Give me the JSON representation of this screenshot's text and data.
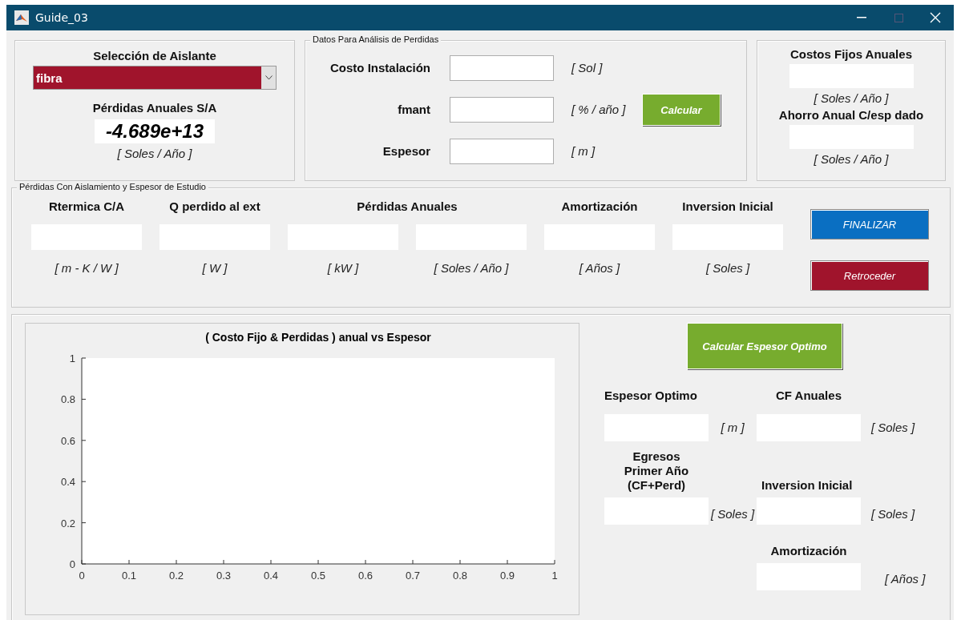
{
  "window": {
    "title": "Guide_03"
  },
  "aislante": {
    "heading": "Selección de Aislante",
    "dropdown": {
      "value": "fibra"
    },
    "loss_label": "Pérdidas Anuales S/A",
    "loss_value": "-4.689e+13",
    "unit": "[ Soles / Año ]"
  },
  "datos": {
    "title": "Datos Para Análisis de Perdidas",
    "rows": [
      {
        "label": "Costo Instalación",
        "unit": "[ Sol ]"
      },
      {
        "label": "fmant",
        "unit": "[ % / año ]"
      },
      {
        "label": "Espesor",
        "unit": "[ m ]"
      }
    ],
    "button": "Calcular"
  },
  "costos": {
    "items": [
      {
        "label": "Costos Fijos Anuales",
        "unit": "[ Soles / Año ]"
      },
      {
        "label": "Ahorro Anual C/esp dado",
        "unit": "[ Soles / Año ]"
      }
    ]
  },
  "estudio": {
    "title": "Pérdidas Con Aislamiento y Espesor de Estudio",
    "columns": [
      {
        "label": "Rtermica C/A",
        "units": [
          "[ m - K / W ]"
        ]
      },
      {
        "label": "Q perdido al ext",
        "units": [
          "[ W ]"
        ]
      },
      {
        "label": "Pérdidas Anuales",
        "units": [
          "[ kW ]",
          "[ Soles / Año ]"
        ]
      },
      {
        "label": "Amortización",
        "units": [
          "[ Años ]"
        ]
      },
      {
        "label": "Inversion Inicial",
        "units": [
          "[ Soles ]"
        ]
      }
    ],
    "buttons": [
      {
        "label": "FINALIZAR",
        "kind": "primary"
      },
      {
        "label": "Retroceder",
        "kind": "danger"
      }
    ]
  },
  "optimo": {
    "chart_data": {
      "type": "line",
      "title": "( Costo Fijo & Perdidas ) anual vs Espesor",
      "xlim": [
        0,
        1
      ],
      "ylim": [
        0,
        1
      ],
      "xticks": [
        0,
        0.1,
        0.2,
        0.3,
        0.4,
        0.5,
        0.6,
        0.7,
        0.8,
        0.9,
        1
      ],
      "yticks": [
        0,
        0.2,
        0.4,
        0.6,
        0.8,
        1
      ]
    },
    "button": "Calcular Espesor Optimo",
    "results": [
      {
        "label": "Espesor Optimo",
        "unit": "[ m ]"
      },
      {
        "label": "CF Anuales",
        "unit": "[ Soles ]"
      },
      {
        "label": "Egresos Primer Año (CF+Perd)",
        "unit": "[ Soles ]"
      },
      {
        "label": "Inversion Inicial",
        "unit": "[ Soles ]"
      },
      {
        "label": "Amortización",
        "unit": "[ Años ]"
      }
    ]
  }
}
